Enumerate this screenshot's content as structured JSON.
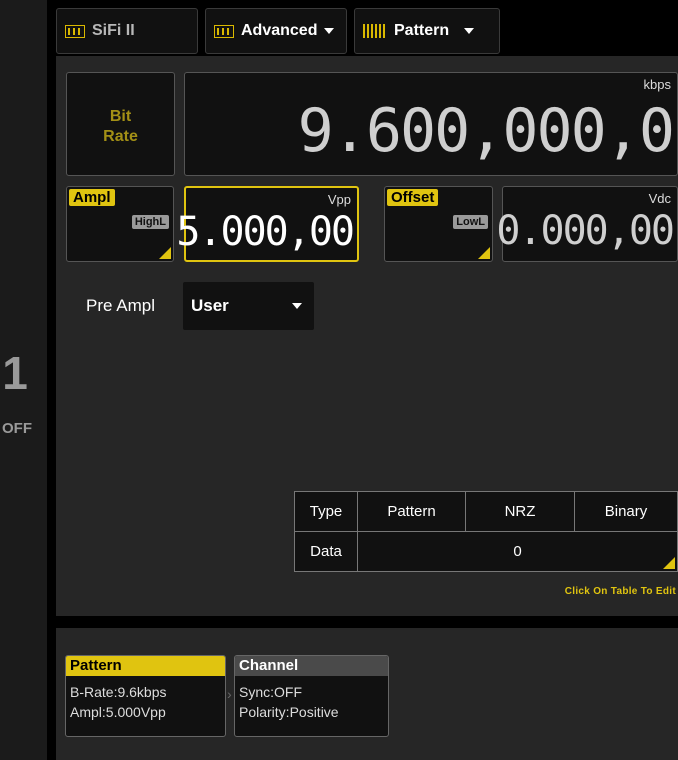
{
  "tabs": {
    "sifi": "SiFi II",
    "advanced": "Advanced",
    "pattern": "Pattern"
  },
  "channel": {
    "number": "1",
    "state": "OFF"
  },
  "bit_rate": {
    "label_line1": "Bit",
    "label_line2": "Rate",
    "value": "9.600,000,0",
    "unit": "kbps"
  },
  "ampl": {
    "label": "Ampl",
    "limit": "HighL",
    "value": "5.000,00",
    "unit": "Vpp"
  },
  "offset": {
    "label": "Offset",
    "limit": "LowL",
    "value": "0.000,00",
    "unit": "Vdc"
  },
  "pre_ampl": {
    "label": "Pre Ampl",
    "value": "User"
  },
  "table": {
    "row1": [
      "Type",
      "Pattern",
      "NRZ",
      "Binary"
    ],
    "row2": [
      "Data",
      "0"
    ],
    "hint": "Click On Table To Edit"
  },
  "cards": {
    "pattern": {
      "title": "Pattern",
      "line1": "B-Rate:9.6kbps",
      "line2": "Ampl:5.000Vpp"
    },
    "channel": {
      "title": "Channel",
      "line1": "Sync:OFF",
      "line2": "Polarity:Positive"
    }
  },
  "colors": {
    "accent": "#e0c410",
    "background": "#000000",
    "panel": "#262626"
  },
  "icons": [
    "sifi-icon",
    "advanced-icon",
    "pattern-wave-icon",
    "chevron-down-icon"
  ]
}
